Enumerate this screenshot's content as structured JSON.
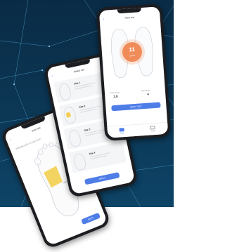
{
  "phone1": {
    "title": "Scan tab",
    "prompt": "Indicate pain in your foot?",
    "region_label": "Heel",
    "button": "NEXT"
  },
  "phone2": {
    "title": "Select site",
    "sites": [
      {
        "label": "Site 1"
      },
      {
        "label": "Site 2"
      },
      {
        "label": "Site 3"
      },
      {
        "label": "Site 4"
      }
    ],
    "button": "APPLY"
  },
  "phone3": {
    "title": "Heel test",
    "score": "11",
    "score_unit": "points",
    "stat_left_label": "Pain score",
    "stat_left_value": "3.8",
    "stat_right_label": "Sensitivity",
    "stat_right_value": "4",
    "button": "SEND TEST",
    "tabs": [
      "Main",
      "Tests"
    ]
  },
  "colors": {
    "accent": "#4f7de8",
    "score_circle": "#f08c5a",
    "highlight": "#f3cf4f",
    "background": "#0b3552"
  }
}
